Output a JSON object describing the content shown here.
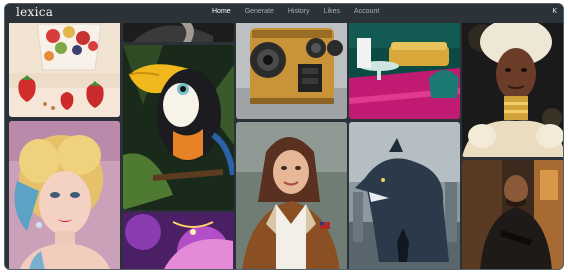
{
  "app": {
    "logo": "lexica"
  },
  "nav": {
    "items": [
      "Home",
      "Generate",
      "History",
      "Likes",
      "Account"
    ],
    "active": "Home",
    "avatar_initial": "K"
  },
  "gallery": {
    "images": [
      {
        "id": "strawberry-parfait",
        "subject": "fruit-dessert"
      },
      {
        "id": "toucan",
        "subject": "bird-illustration"
      },
      {
        "id": "retro-camera",
        "subject": "vintage-camera"
      },
      {
        "id": "pink-lounge",
        "subject": "interior-room"
      },
      {
        "id": "gold-portrait",
        "subject": "woman-portrait"
      },
      {
        "id": "retro-blonde",
        "subject": "woman-portrait"
      },
      {
        "id": "pilot-woman",
        "subject": "woman-portrait"
      },
      {
        "id": "beast-monster",
        "subject": "creature"
      },
      {
        "id": "man-street",
        "subject": "man-portrait"
      },
      {
        "id": "purple-abstract",
        "subject": "abstract"
      }
    ]
  },
  "colors": {
    "background": "#2a3238",
    "topbar": "#2b3338",
    "text_active": "#ffffff",
    "text_muted": "#a9b1b6"
  }
}
